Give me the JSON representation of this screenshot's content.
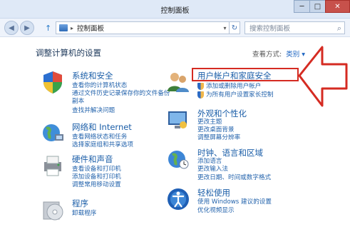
{
  "window": {
    "title": "控制面板",
    "controls": {
      "minimize": "─",
      "maximize": "□",
      "close": "✕"
    }
  },
  "nav": {
    "back_icon": "◀",
    "forward_icon": "▶",
    "up_icon": "↑",
    "breadcrumb": "控制面板",
    "address_separator": "▸",
    "dropdown_icon": "▾",
    "refresh_icon": "↻",
    "search_placeholder": "搜索控制面板",
    "search_icon": "⌕"
  },
  "main": {
    "heading": "调整计算机的设置",
    "view_by_label": "查看方式:",
    "view_by_value": "类别 ▾"
  },
  "categories": {
    "system": {
      "title": "系统和安全",
      "links": [
        "查看你的计算机状态",
        "通过文件历史记录保存你的文件备份",
        "副本",
        "查找并解决问题"
      ]
    },
    "network": {
      "title": "网络和 Internet",
      "links": [
        "查看网络状态和任务",
        "选择家庭组和共享选项"
      ]
    },
    "hardware": {
      "title": "硬件和声音",
      "links": [
        "查看设备和打印机",
        "添加设备和打印机",
        "调整常用移动设置"
      ]
    },
    "programs": {
      "title": "程序",
      "links": [
        "卸载程序"
      ]
    },
    "users": {
      "title": "用户帐户和家庭安全",
      "links": [
        "添加或删除用户帐户",
        "为所有用户设置家长控制"
      ]
    },
    "appearance": {
      "title": "外观和个性化",
      "links": [
        "更改主题",
        "更改桌面背景",
        "调整屏幕分辨率"
      ]
    },
    "clock": {
      "title": "时钟、语言和区域",
      "links": [
        "添加语言",
        "更改输入法",
        "更改日期、时间或数字格式"
      ]
    },
    "ease": {
      "title": "轻松使用",
      "links": [
        "使用 Windows 建议的设置",
        "优化视频显示"
      ]
    }
  },
  "colors": {
    "highlight_border": "#d52b22",
    "link": "#2363ac",
    "category_title": "#1b5ea8"
  }
}
